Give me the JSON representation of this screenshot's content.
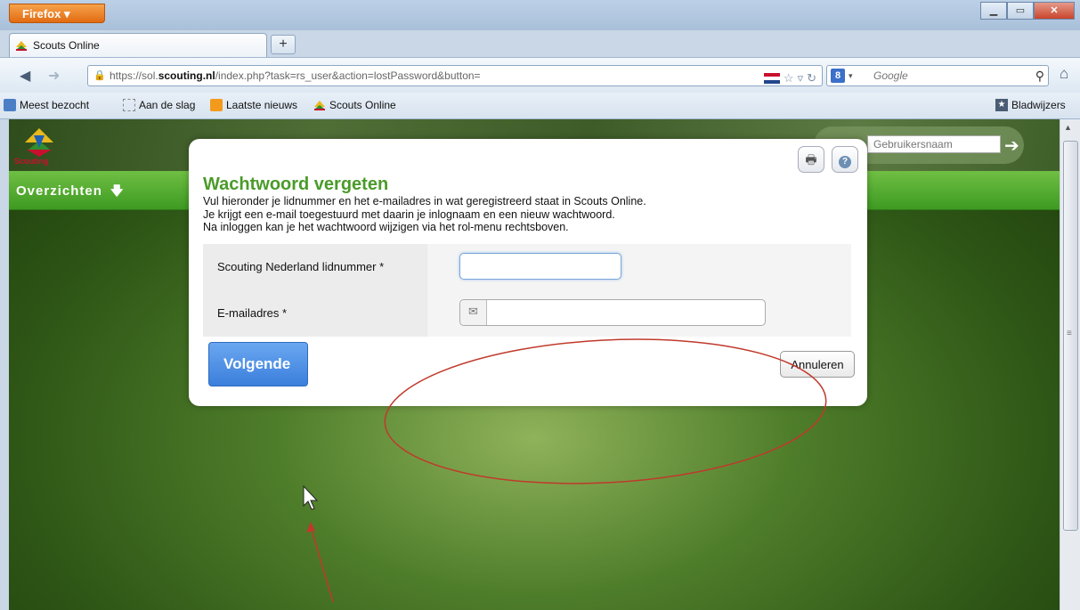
{
  "browser": {
    "menu_button": "Firefox ▾",
    "tab_title": "Scouts Online",
    "new_tab": "+",
    "url_prefix": "https://sol.",
    "url_domain": "scouting.nl",
    "url_path": "/index.php?task=rs_user&action=lostPassword&button=",
    "search_placeholder": "Google",
    "bookmarks": [
      "Meest bezocht",
      "Aan de slag",
      "Laatste nieuws",
      "Scouts Online"
    ],
    "bookmarks_menu": "Bladwijzers"
  },
  "site": {
    "logo_text": "Scouting",
    "login_placeholder": "Gebruikersnaam",
    "menu_label": "Overzichten"
  },
  "dialog": {
    "title": "Wachtwoord vergeten",
    "intro_lines": [
      "Vul hieronder je lidnummer en het e-mailadres in wat geregistreerd staat in Scouts Online.",
      "Je krijgt een e-mail toegestuurd met daarin je inlognaam en een nieuw wachtwoord.",
      "Na inloggen kan je het wachtwoord wijzigen via het rol-menu rechtsboven."
    ],
    "fields": {
      "member_label": "Scouting Nederland lidnummer *",
      "member_value": "",
      "email_label": "E-mailadres *",
      "email_value": ""
    },
    "next_button": "Volgende",
    "cancel_button": "Annuleren"
  },
  "colors": {
    "menu_green": "#4caf2a",
    "title_green": "#4a9b2a",
    "primary_blue": "#3b7fdc",
    "annotation_red": "#c0392b"
  },
  "icons": [
    "firefox-menu-icon",
    "back-icon",
    "forward-icon",
    "lock-icon",
    "bookmark-star-icon",
    "reload-icon",
    "search-icon",
    "home-icon",
    "print-icon",
    "help-icon",
    "mail-icon",
    "arrow-right-icon",
    "arrow-down-icon",
    "cursor-icon"
  ]
}
